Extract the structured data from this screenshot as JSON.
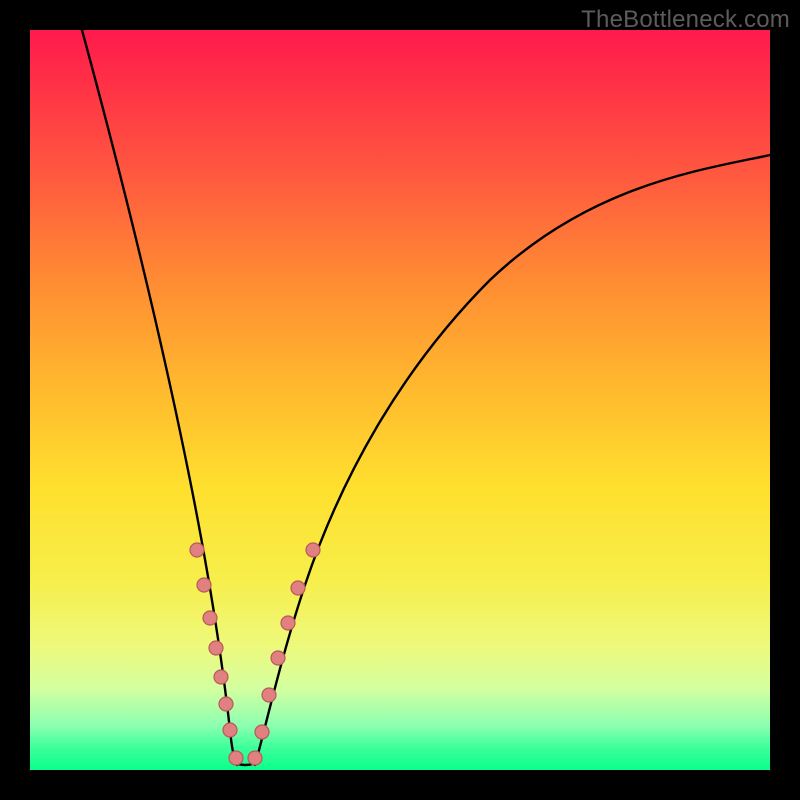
{
  "watermark": "TheBottleneck.com",
  "chart_data": {
    "type": "line",
    "title": "",
    "xlabel": "",
    "ylabel": "",
    "xlim": [
      0,
      100
    ],
    "ylim": [
      0,
      100
    ],
    "grid": false,
    "legend": false,
    "background": {
      "gradient_stops": [
        {
          "pos": 0,
          "color": "#ff1a4d"
        },
        {
          "pos": 0.5,
          "color": "#ffb82e"
        },
        {
          "pos": 0.75,
          "color": "#f7ee4a"
        },
        {
          "pos": 1,
          "color": "#0aff8c"
        }
      ]
    },
    "series": [
      {
        "name": "left-branch",
        "x": [
          7,
          9,
          11,
          13,
          15,
          17,
          19,
          21,
          23,
          24,
          25,
          26,
          27
        ],
        "y": [
          100,
          88,
          77,
          67,
          58,
          50,
          42,
          34,
          26,
          22,
          17,
          11,
          4
        ]
      },
      {
        "name": "right-branch",
        "x": [
          31,
          33,
          35,
          38,
          42,
          48,
          56,
          66,
          78,
          92,
          100
        ],
        "y": [
          4,
          12,
          19,
          27,
          36,
          46,
          56,
          65,
          73,
          80,
          83
        ]
      },
      {
        "name": "valley-floor",
        "x": [
          27,
          28,
          29,
          30,
          31
        ],
        "y": [
          1,
          0.5,
          0.5,
          0.5,
          1
        ]
      }
    ],
    "markers": [
      {
        "series": "left-branch",
        "x": 22.5,
        "y": 30
      },
      {
        "series": "left-branch",
        "x": 23.5,
        "y": 25
      },
      {
        "series": "left-branch",
        "x": 24.3,
        "y": 20.5
      },
      {
        "series": "left-branch",
        "x": 25.0,
        "y": 16.5
      },
      {
        "series": "left-branch",
        "x": 25.8,
        "y": 12.5
      },
      {
        "series": "left-branch",
        "x": 26.4,
        "y": 9
      },
      {
        "series": "left-branch",
        "x": 27.0,
        "y": 5.5
      },
      {
        "series": "valley-floor",
        "x": 27.8,
        "y": 1.5
      },
      {
        "series": "valley-floor",
        "x": 30.4,
        "y": 1.5
      },
      {
        "series": "right-branch",
        "x": 31.3,
        "y": 5
      },
      {
        "series": "right-branch",
        "x": 32.3,
        "y": 10
      },
      {
        "series": "right-branch",
        "x": 33.5,
        "y": 15
      },
      {
        "series": "right-branch",
        "x": 34.8,
        "y": 20
      },
      {
        "series": "right-branch",
        "x": 36.2,
        "y": 25
      },
      {
        "series": "right-branch",
        "x": 38.2,
        "y": 30
      }
    ]
  }
}
